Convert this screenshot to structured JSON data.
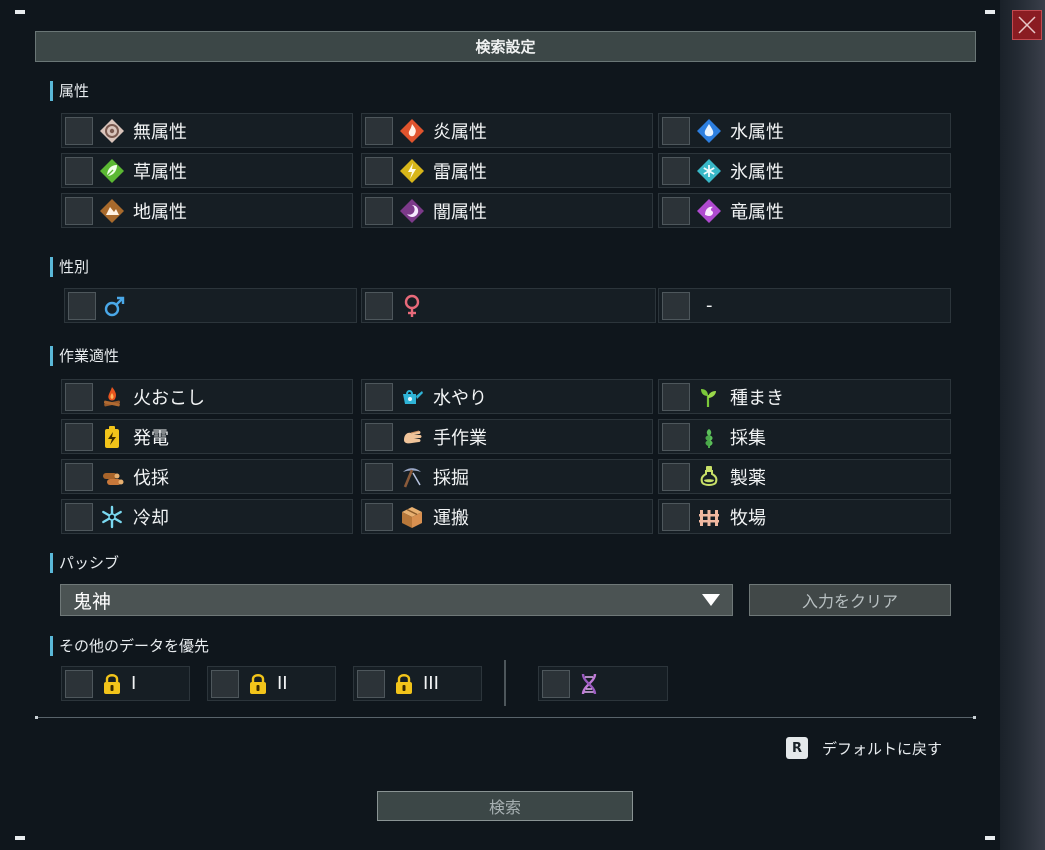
{
  "title": "検索設定",
  "sections": {
    "element": "属性",
    "gender": "性別",
    "work": "作業適性",
    "passive": "パッシブ",
    "priority": "その他のデータを優先"
  },
  "elements": [
    {
      "label": "無属性",
      "icon": "neutral-element-icon",
      "color": "#c9b3aa"
    },
    {
      "label": "炎属性",
      "icon": "fire-element-icon",
      "color": "#e0542d"
    },
    {
      "label": "水属性",
      "icon": "water-element-icon",
      "color": "#2d7fe0"
    },
    {
      "label": "草属性",
      "icon": "grass-element-icon",
      "color": "#5bb833"
    },
    {
      "label": "雷属性",
      "icon": "electric-element-icon",
      "color": "#d8b61a"
    },
    {
      "label": "氷属性",
      "icon": "ice-element-icon",
      "color": "#39b8c8"
    },
    {
      "label": "地属性",
      "icon": "ground-element-icon",
      "color": "#a86a2c"
    },
    {
      "label": "闇属性",
      "icon": "dark-element-icon",
      "color": "#7c3a8a"
    },
    {
      "label": "竜属性",
      "icon": "dragon-element-icon",
      "color": "#b04ad0"
    }
  ],
  "genders": [
    {
      "label": "",
      "icon": "male-icon",
      "color": "#4aa8e8"
    },
    {
      "label": "",
      "icon": "female-icon",
      "color": "#e86a7a"
    },
    {
      "label": "-",
      "icon": "",
      "color": ""
    }
  ],
  "work": [
    {
      "label": "火おこし",
      "icon": "kindling-icon"
    },
    {
      "label": "水やり",
      "icon": "watering-icon"
    },
    {
      "label": "種まき",
      "icon": "planting-icon"
    },
    {
      "label": "発電",
      "icon": "electricity-icon"
    },
    {
      "label": "手作業",
      "icon": "handiwork-icon"
    },
    {
      "label": "採集",
      "icon": "gathering-icon"
    },
    {
      "label": "伐採",
      "icon": "lumbering-icon"
    },
    {
      "label": "採掘",
      "icon": "mining-icon"
    },
    {
      "label": "製薬",
      "icon": "medicine-icon"
    },
    {
      "label": "冷却",
      "icon": "cooling-icon"
    },
    {
      "label": "運搬",
      "icon": "transporting-icon"
    },
    {
      "label": "牧場",
      "icon": "farming-icon"
    }
  ],
  "passive": {
    "selected": "鬼神",
    "clear_label": "入力をクリア"
  },
  "priority": [
    {
      "label": "I",
      "icon": "lock-icon"
    },
    {
      "label": "II",
      "icon": "lock-icon"
    },
    {
      "label": "III",
      "icon": "lock-icon"
    },
    {
      "label": "",
      "icon": "dna-icon"
    }
  ],
  "reset": {
    "key": "R",
    "label": "デフォルトに戻す"
  },
  "search_label": "検索"
}
